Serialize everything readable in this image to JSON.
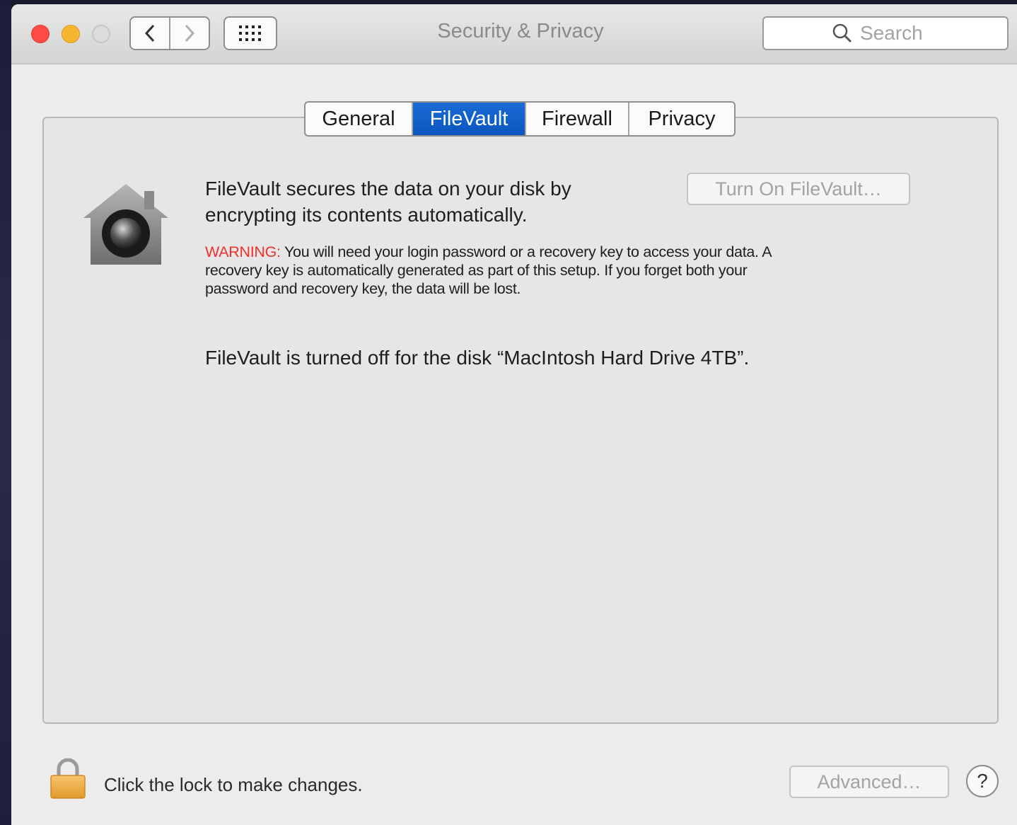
{
  "window": {
    "title": "Security & Privacy",
    "search_placeholder": "Search"
  },
  "tabs": [
    {
      "label": "General",
      "active": false
    },
    {
      "label": "FileVault",
      "active": true
    },
    {
      "label": "Firewall",
      "active": false
    },
    {
      "label": "Privacy",
      "active": false
    }
  ],
  "filevault": {
    "description_line1": "FileVault secures the data on your disk by",
    "description_line2": "encrypting its contents automatically.",
    "turn_on_button": "Turn On FileVault…",
    "warning_label": "WARNING:",
    "warning_line1": " You will need your login password or a recovery key to access your data. A",
    "warning_line2": "recovery key is automatically generated as part of this setup. If you forget both your",
    "warning_line3": "password and recovery key, the data will be lost.",
    "status": "FileVault is turned off for the disk “MacIntosh Hard Drive 4TB”."
  },
  "footer": {
    "lock_text": "Click the lock to make changes.",
    "advanced_button": "Advanced…",
    "help_button": "?"
  },
  "colors": {
    "accent": "#0b56bf",
    "warning": "#f0302a",
    "close": "#fc4b45",
    "minimize": "#f6b530"
  }
}
